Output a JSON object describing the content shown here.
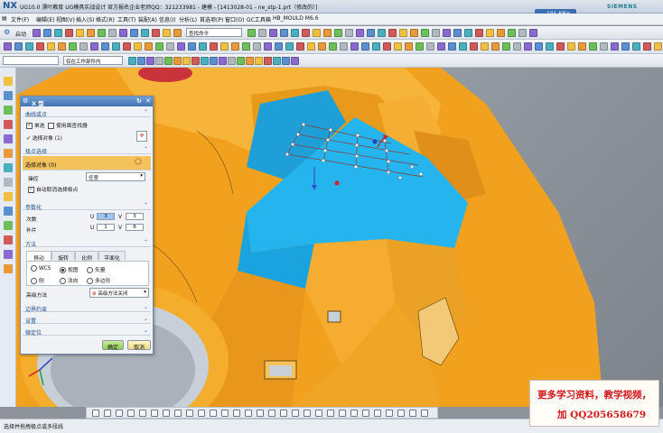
{
  "window": {
    "app_logo": "NX",
    "title": "UG10.0 漂叶教育 UG模具实战设计 官方报名企业老师QQ：321233981 - 建模 - [1413028-01 - ne_stp-1.prt（修改的）]",
    "brand": "SIEMENS",
    "speed_badge": "101 KB/s",
    "controls": [
      "_",
      "□",
      "×"
    ]
  },
  "menubar": {
    "items": [
      "文件(F)",
      "编辑(E)",
      "视图(V)",
      "插入(S)",
      "格式(R)",
      "工具(T)",
      "装配(A)",
      "信息(I)",
      "分析(L)",
      "首选项(P)",
      "窗口(O)",
      "GC工具箱",
      "HB_MOULD M6.6"
    ]
  },
  "toolbar": {
    "start_label": "启动",
    "command_search": "查找命令",
    "filter_select": "",
    "scope_select": "仅在工作部件内"
  },
  "dialog": {
    "title": "X 型",
    "sections": {
      "curve_or_points": "曲线或点",
      "pole_select": "极点选择",
      "parameterization": "参数化",
      "method": "方法",
      "boundary": "边界约束",
      "settings": "设置",
      "fine_tune": "微定位"
    },
    "single_select": "单选",
    "use_surface_filter": "使用面查找器",
    "select_object_curve": "选择对象 (1)",
    "select_object_pole": "选择对象 (0)",
    "manipulate_label": "操控",
    "manipulate_value": "任意",
    "auto_deselect": "自动取消选择极点",
    "degree_label": "次数",
    "segments_label": "补片",
    "u_label": "U",
    "v_label": "V",
    "degree_u": "3",
    "degree_v": "3",
    "segments_u": "1",
    "segments_v": "8",
    "tabs": [
      "移动",
      "旋转",
      "比例",
      "平面化"
    ],
    "radio_options": [
      "WCS",
      "视图",
      "矢量",
      "刨",
      "法向",
      "多边形"
    ],
    "radio_selected": "视图",
    "advanced_method_label": "高级方法",
    "advanced_method_value": "高级方法关闭",
    "ok": "确定",
    "cancel": "取消"
  },
  "status": {
    "text": "选择并拖拽极点或多段线"
  },
  "promo": {
    "line1": "更多学习资料，教学视频，",
    "line2": "加 QQ205658679"
  },
  "colors": {
    "part_orange": "#f2a11f",
    "face_cyan": "#24b4ee",
    "title_blue": "#3f73b4",
    "promo_red": "#d4141a"
  }
}
